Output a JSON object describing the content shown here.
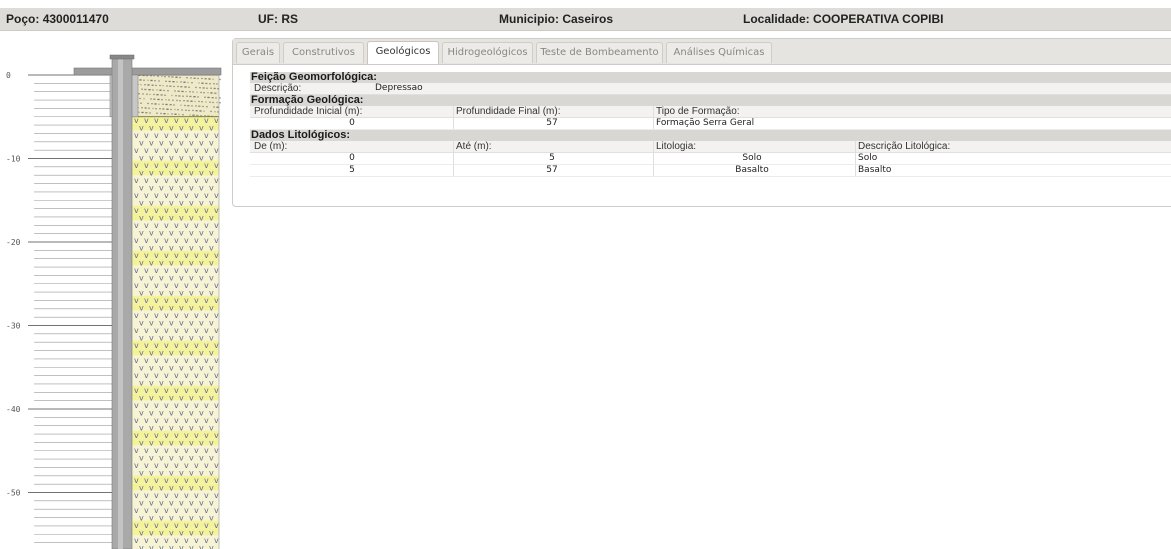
{
  "header": {
    "poco_label": "Poço:",
    "poco_value": "4300011470",
    "uf_label": "UF:",
    "uf_value": "RS",
    "municipio_label": "Municipio:",
    "municipio_value": "Caseiros",
    "localidade_label": "Localidade:",
    "localidade_value": "COOPERATIVA COPIBI"
  },
  "tabs": [
    {
      "label": "Gerais",
      "active": false
    },
    {
      "label": "Construtivos",
      "active": false
    },
    {
      "label": "Geológicos",
      "active": true
    },
    {
      "label": "Hidrogeológicos",
      "active": false
    },
    {
      "label": "Teste de Bombeamento",
      "active": false
    },
    {
      "label": "Análises Químicas",
      "active": false
    }
  ],
  "geomorfologia": {
    "title": "Feição Geomorfológica:",
    "descricao_label": "Descrição:",
    "descricao_value": "Depressao"
  },
  "formacao": {
    "title": "Formação Geológica:",
    "headers": [
      "Profundidade Inicial (m):",
      "Profundidade Final (m):",
      "Tipo de Formação:"
    ],
    "rows": [
      [
        "0",
        "57",
        "Formação Serra Geral"
      ]
    ]
  },
  "litologia": {
    "title": "Dados Litológicos:",
    "headers": [
      "De (m):",
      "Até (m):",
      "Litologia:",
      "Descrição Litológica:"
    ],
    "rows": [
      [
        "0",
        "5",
        "Solo",
        "Solo"
      ],
      [
        "5",
        "57",
        "Basalto",
        "Basalto"
      ]
    ]
  },
  "well_log": {
    "depth_labels": [
      "0",
      "-10",
      "-20",
      "-30",
      "-40",
      "-50"
    ],
    "layers": [
      {
        "lithology": "Solo",
        "from": 0,
        "to": 5,
        "color": "#eee9c8"
      },
      {
        "lithology": "Basalto",
        "from": 5,
        "to": 57,
        "color": "#f6f4d4"
      }
    ]
  },
  "colors": {
    "header_bg": "#dedcd8",
    "section_bg": "#d9d7d3",
    "pipe": "#a9a9a9",
    "basalt_mark": "#6b6b8a",
    "basalt_band": "#f2f26a"
  }
}
